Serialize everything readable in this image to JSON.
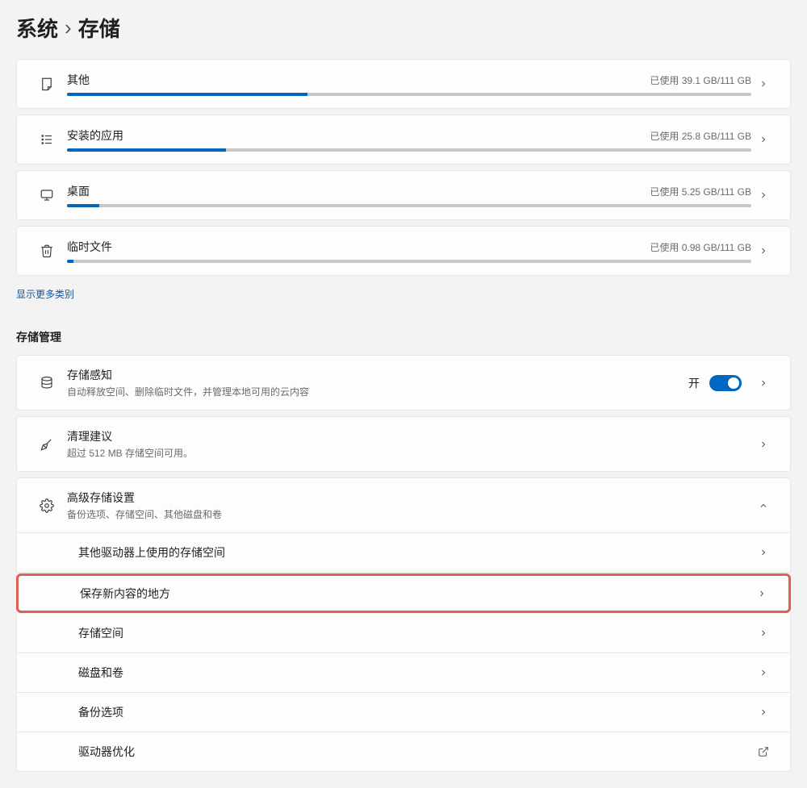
{
  "breadcrumb": {
    "parent": "系统",
    "current": "存储"
  },
  "storage_items": [
    {
      "icon": "sticky-note",
      "title": "其他",
      "usage": "已使用 39.1 GB/111 GB",
      "pct": 35.2
    },
    {
      "icon": "list",
      "title": "安装的应用",
      "usage": "已使用 25.8 GB/111 GB",
      "pct": 23.2
    },
    {
      "icon": "monitor",
      "title": "桌面",
      "usage": "已使用 5.25 GB/111 GB",
      "pct": 4.7
    },
    {
      "icon": "trash",
      "title": "临时文件",
      "usage": "已使用 0.98 GB/111 GB",
      "pct": 0.9
    }
  ],
  "show_more_label": "显示更多类别",
  "mgmt_section_label": "存储管理",
  "sense": {
    "title": "存储感知",
    "sub": "自动释放空间、删除临时文件，并管理本地可用的云内容",
    "toggle_label": "开",
    "on": true
  },
  "cleanup": {
    "title": "清理建议",
    "sub": "超过 512 MB 存储空间可用。"
  },
  "advanced": {
    "title": "高级存储设置",
    "sub": "备份选项、存储空间、其他磁盘和卷",
    "items": [
      {
        "label": "其他驱动器上使用的存储空间",
        "trailing": "chev"
      },
      {
        "label": "保存新内容的地方",
        "trailing": "chev",
        "highlighted": true
      },
      {
        "label": "存储空间",
        "trailing": "chev"
      },
      {
        "label": "磁盘和卷",
        "trailing": "chev"
      },
      {
        "label": "备份选项",
        "trailing": "chev"
      },
      {
        "label": "驱动器优化",
        "trailing": "external"
      }
    ]
  }
}
